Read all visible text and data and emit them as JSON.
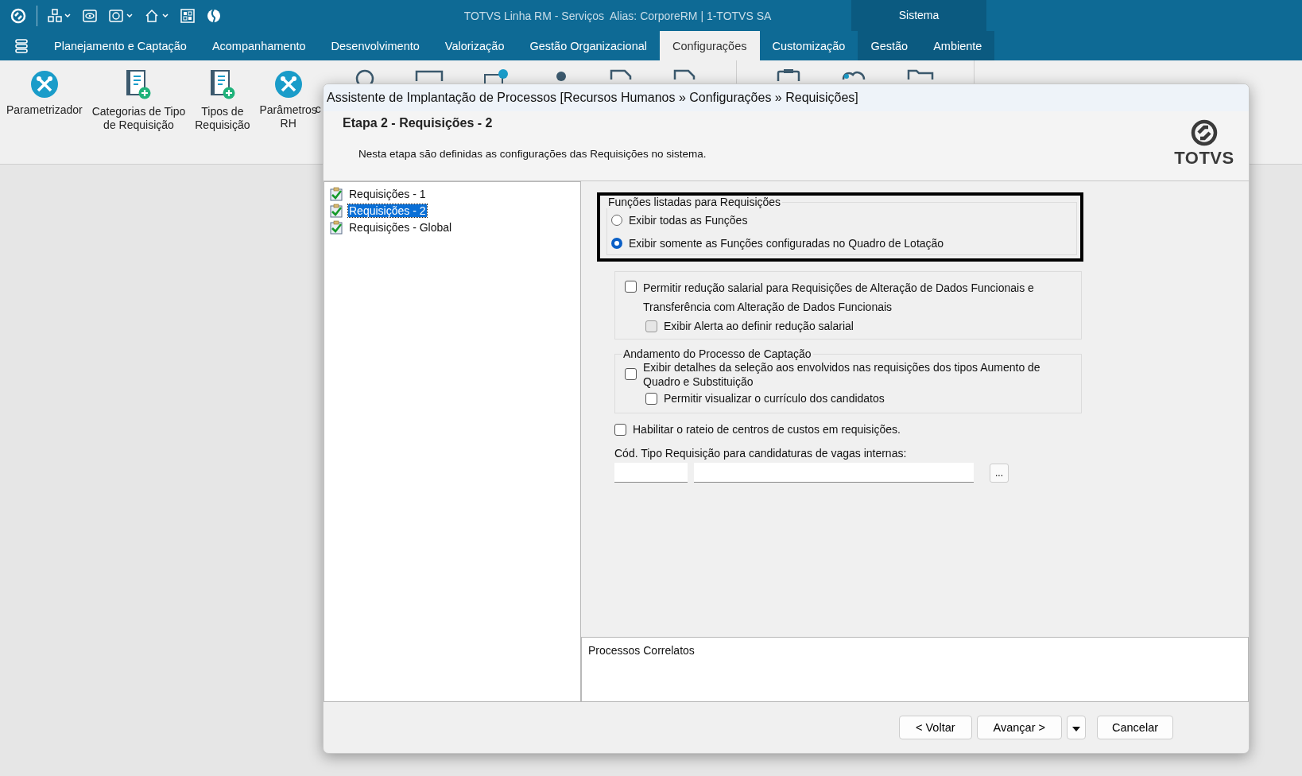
{
  "app_bar": {
    "title": "TOTVS Linha RM - Serviços  Alias: CorporeRM | 1-TOTVS SA",
    "section": "Sistema"
  },
  "menu": [
    {
      "label": "Planejamento e Captação",
      "selected": false
    },
    {
      "label": "Acompanhamento",
      "selected": false
    },
    {
      "label": "Desenvolvimento",
      "selected": false
    },
    {
      "label": "Valorização",
      "selected": false
    },
    {
      "label": "Gestão Organizacional",
      "selected": false
    },
    {
      "label": "Configurações",
      "selected": true
    },
    {
      "label": "Customização",
      "selected": false
    },
    {
      "label": "Gestão",
      "selected": false
    },
    {
      "label": "Ambiente",
      "selected": false
    }
  ],
  "ribbon": [
    {
      "label": "Parametrizador",
      "kind": "tools"
    },
    {
      "label": "Categorias de Tipo\nde Requisição",
      "kind": "doc"
    },
    {
      "label": "Tipos de\nRequisição",
      "kind": "doc"
    },
    {
      "label": "Parâmetros\nRH",
      "kind": "tools"
    },
    {
      "label": "c",
      "kind": "covered"
    }
  ],
  "dialog": {
    "title": "Assistente de Implantação de Processos [Recursos Humanos » Configurações » Requisições]",
    "step_title": "Etapa 2 - Requisições - 2",
    "description": "Nesta etapa são definidas as configurações das Requisições no sistema.",
    "logo": "TOTVS",
    "tree": [
      {
        "label": "Requisições - 1",
        "selected": false
      },
      {
        "label": "Requisições - 2",
        "selected": true
      },
      {
        "label": "Requisições - Global",
        "selected": false
      }
    ],
    "functions_group": {
      "legend": "Funções listadas para Requisições",
      "options": [
        {
          "label": "Exibir todas as Funções",
          "selected": false
        },
        {
          "label": "Exibir somente as Funções configuradas no Quadro de Lotação",
          "selected": true
        }
      ]
    },
    "salary_group": {
      "option": {
        "label": "Permitir redução salarial para Requisições de Alteração de Dados Funcionais e\nTransferência com Alteração de Dados Funcionais",
        "checked": false
      },
      "sub_option": {
        "label": "Exibir Alerta ao definir redução salarial",
        "checked": false,
        "disabled": true
      }
    },
    "capture_group": {
      "legend": "Andamento do Processo de Captação",
      "option": {
        "label": "Exibir detalhes da seleção aos envolvidos nas requisições dos tipos Aumento de\nQuadro e Substituição",
        "checked": false
      },
      "sub_option": {
        "label": "Permitir visualizar o currículo dos candidatos",
        "checked": false,
        "disabled": false
      }
    },
    "cost_option": {
      "label": "Habilitar o rateio de centros de custos em requisições.",
      "checked": false
    },
    "code_field": {
      "label": "Cód. Tipo Requisição para candidaturas de vagas internas:",
      "lookup_button": "..."
    },
    "related": {
      "title": "Processos Correlatos"
    },
    "buttons": {
      "back": "< Voltar",
      "next": "Avançar >",
      "cancel": "Cancelar"
    }
  }
}
